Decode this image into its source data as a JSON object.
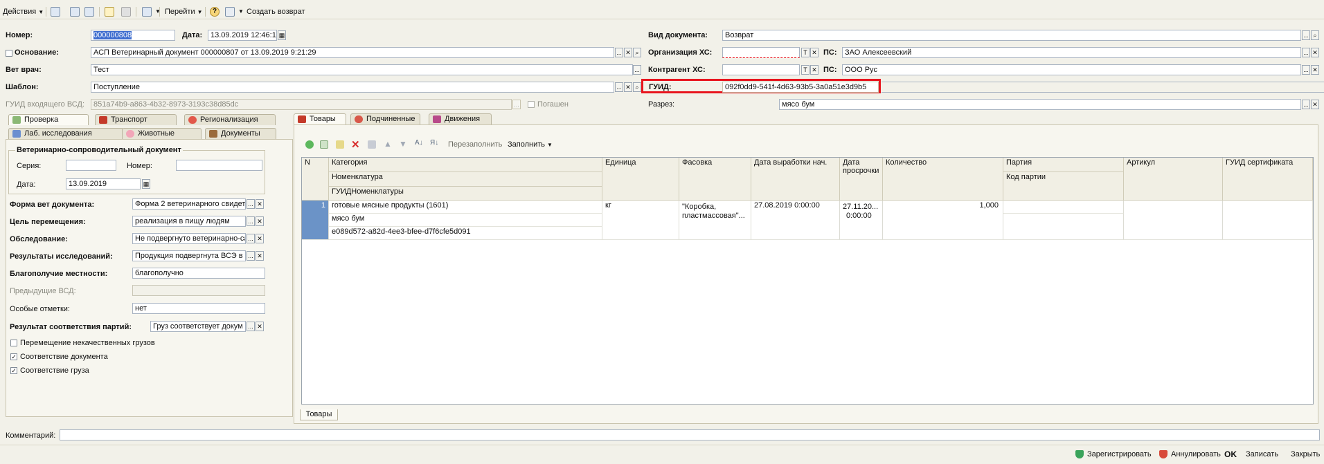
{
  "toolbar": {
    "actions": "Действия",
    "goto": "Перейти",
    "create_return": "Создать возврат"
  },
  "header": {
    "number_label": "Номер:",
    "number_value": "000000808",
    "date_label": "Дата:",
    "date_value": "13.09.2019 12:46:1",
    "doc_type_label": "Вид документа:",
    "doc_type_value": "Возврат",
    "basis_label": "Основание:",
    "basis_value": "АСП Ветеринарный документ 000000807 от 13.09.2019 9:21:29",
    "org_label": "Организация ХС:",
    "org_value": "",
    "ps_label": "ПС:",
    "org_ps_value": "ЗАО Алексеевский",
    "vet_label": "Вет врач:",
    "vet_value": "Тест",
    "contractor_label": "Контрагент ХС:",
    "contractor_value": "",
    "contractor_ps_value": "ООО Рус",
    "template_label": "Шаблон:",
    "template_value": "Поступление",
    "guid_label": "ГУИД:",
    "guid_value": "092f0dd9-541f-4d63-93b5-3a0a51e3d9b5",
    "incoming_guid_label": "ГУИД входящего ВСД:",
    "incoming_guid_value": "851a74b9-a863-4b32-8973-3193c38d85dc",
    "cancelled_label": "Погашен",
    "cut_label": "Разрез:",
    "cut_value": "мясо бум",
    "t_letter": "T",
    "x_letter": "✕",
    "dots": "..."
  },
  "left_tabs": {
    "row1": [
      "Проверка",
      "Транспорт",
      "Регионализация"
    ],
    "row2": [
      "Лаб. исследования",
      "Животные",
      "Документы"
    ]
  },
  "vet_doc": {
    "group_title": "Ветеринарно-сопроводительный документ",
    "series_label": "Серия:",
    "series_value": "",
    "number_label": "Номер:",
    "number_value": "",
    "date_label": "Дата:",
    "date_value": "13.09.2019"
  },
  "fields": [
    {
      "label": "Форма вет документа:",
      "value": "Форма 2 ветеринарного свидет"
    },
    {
      "label": "Цель перемещения:",
      "value": "реализация в пищу людям"
    },
    {
      "label": "Обследование:",
      "value": "Не подвергнуто ветеринарно-са"
    },
    {
      "label": "Результаты исследований:",
      "value": "Продукция подвергнута ВСЭ в п"
    },
    {
      "label": "Благополучие местности:",
      "value": "благополучно"
    },
    {
      "label": "Предыдущие ВСД:",
      "value": ""
    },
    {
      "label": "Особые отметки:",
      "value": "нет"
    },
    {
      "label": "Результат соответствия партий:",
      "value": "Груз соответствует докум"
    }
  ],
  "checkboxes": [
    {
      "label": "Перемещение некачественных грузов",
      "checked": false
    },
    {
      "label": "Соответствие документа",
      "checked": true
    },
    {
      "label": "Соответствие груза",
      "checked": true
    }
  ],
  "right_tabs": [
    "Товары",
    "Подчиненные",
    "Движения"
  ],
  "goods_toolbar": {
    "refill": "Перезаполнить",
    "fill": "Заполнить"
  },
  "table": {
    "headers": {
      "n": "N",
      "category": "Категория",
      "nomenclature": "Номенклатура",
      "guid_nom": "ГУИДНоменклатуры",
      "unit": "Единица",
      "packaging": "Фасовка",
      "prod_date": "Дата выработки нач.",
      "expiry_1": "Дата",
      "expiry_2": "просрочки",
      "quantity": "Количество",
      "batch": "Партия",
      "batch_code": "Код партии",
      "article": "Артикул",
      "cert_guid": "ГУИД сертификата"
    },
    "rows": [
      {
        "n": "1",
        "category": "готовые мясные продукты (1601)",
        "nomenclature": "мясо бум",
        "guid_nom": "e089d572-a82d-4ee3-bfee-d7f6cfe5d091",
        "unit": "кг",
        "packaging_1": "\"Коробка,",
        "packaging_2": "пластмассовая\"...",
        "prod_date": "27.08.2019 0:00:00",
        "expiry_1": "27.11.20...",
        "expiry_2": "0:00:00",
        "quantity": "1,000",
        "batch": "",
        "batch_code": "",
        "article": "",
        "cert_guid": ""
      }
    ]
  },
  "bottom_tab": "Товары",
  "comment_label": "Комментарий:",
  "comment_value": "",
  "footer": {
    "register": "Зарегистрировать",
    "cancel": "Аннулировать",
    "ok": "OK",
    "save": "Записать",
    "close": "Закрыть"
  },
  "colors": {
    "highlight": "#e8151e",
    "selection": "#6b93c7",
    "background": "#f2f1e9"
  }
}
